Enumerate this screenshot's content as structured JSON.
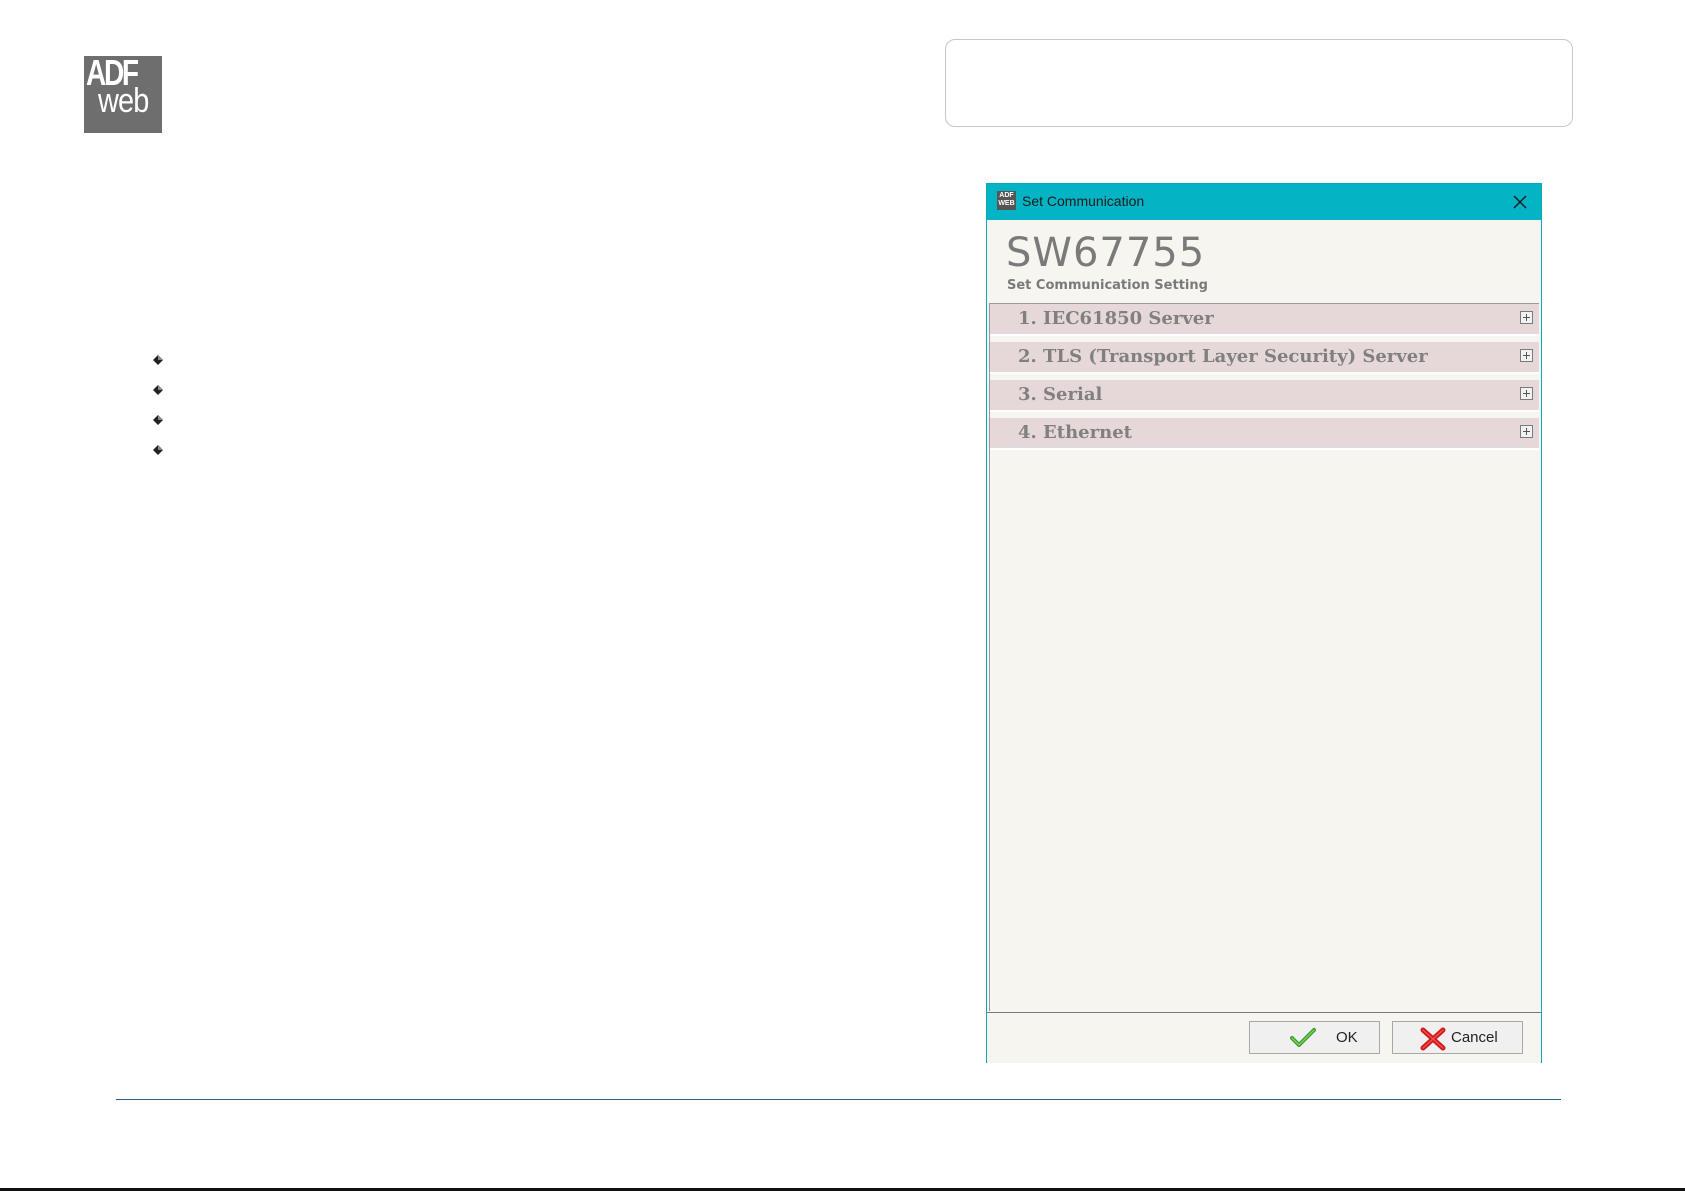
{
  "logo": {
    "brand_top": "ADF",
    "brand_bottom": "web"
  },
  "bullets": [
    {
      "text": ""
    },
    {
      "text": ""
    },
    {
      "text": ""
    },
    {
      "text": ""
    }
  ],
  "dialog": {
    "window_title": "Set Communication",
    "product_code": "SW67755",
    "subtitle": "Set Communication Setting",
    "sections": [
      {
        "label": "1. IEC61850 Server"
      },
      {
        "label": "2. TLS (Transport Layer Security) Server"
      },
      {
        "label": "3. Serial"
      },
      {
        "label": "4. Ethernet"
      }
    ],
    "ok_label": "OK",
    "cancel_label": "Cancel"
  },
  "colors": {
    "titlebar": "#04b4c4",
    "section_bg": "#e6d8d8",
    "panel_bg": "#f6f5ef",
    "footer_rule": "#2e5c8a"
  },
  "icons": {
    "close": "close-icon",
    "expand": "plus-box-icon",
    "ok": "checkmark-icon",
    "cancel": "red-x-icon",
    "bullet": "diamond-bullet-icon"
  }
}
